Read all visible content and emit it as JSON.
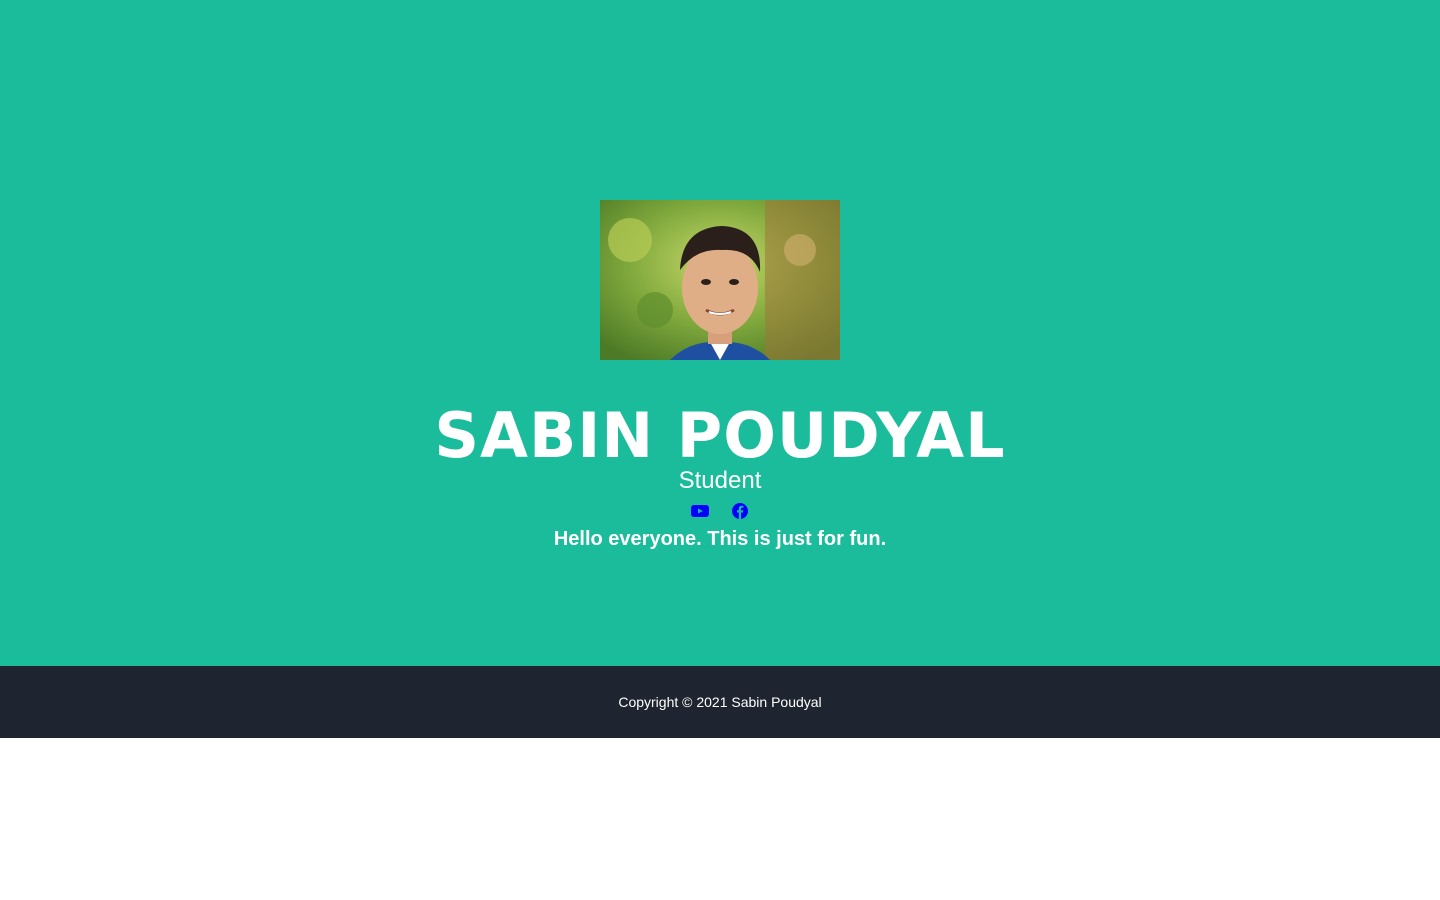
{
  "profile": {
    "name": "SABIN POUDYAL",
    "role": "Student",
    "tagline": "Hello everyone. This is just for fun."
  },
  "socials": [
    {
      "icon": "youtube-icon",
      "color": "#0000ff"
    },
    {
      "icon": "facebook-icon",
      "color": "#0000ff"
    }
  ],
  "footer": {
    "copyright": "Copyright © 2021 Sabin Poudyal"
  },
  "colors": {
    "hero_background": "#1abc9c",
    "footer_background": "#1e2530",
    "text": "#ffffff",
    "icon": "#0000ff"
  }
}
